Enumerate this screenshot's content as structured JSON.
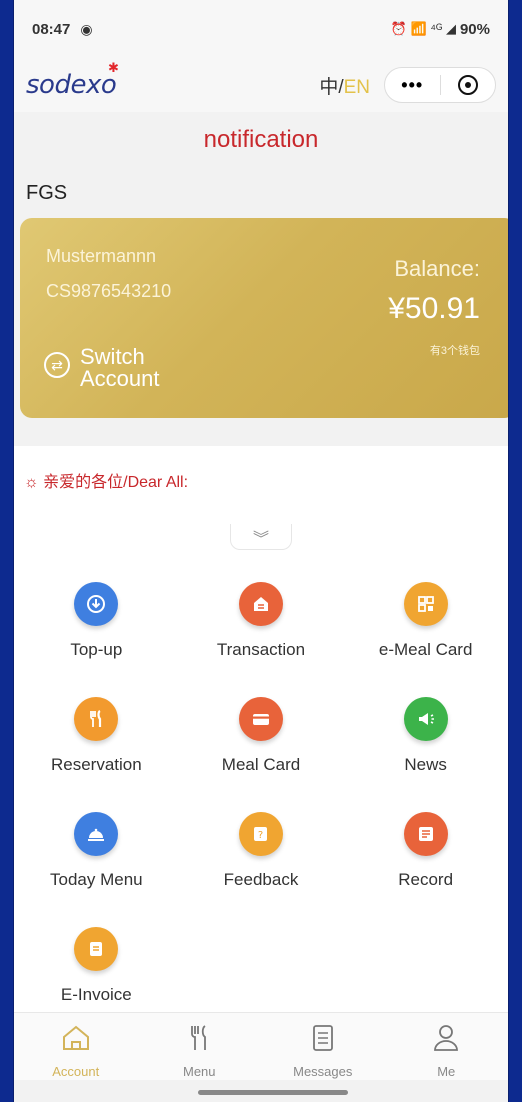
{
  "status_bar": {
    "time": "08:47",
    "indicators": "⏰ 📶 ⁴ᴳ ◢",
    "battery": "90%"
  },
  "header": {
    "logo": "sodexo",
    "lang_zh": "中/",
    "lang_en": "EN",
    "more_label": "•••"
  },
  "page": {
    "title": "notification",
    "org": "FGS"
  },
  "card": {
    "holder": "Mustermannn",
    "account_id": "CS9876543210",
    "switch_label": "Switch Account",
    "balance_label": "Balance:",
    "balance": "¥50.91",
    "wallets": "有3个钱包"
  },
  "notice": {
    "text": "亲爱的各位/Dear All:"
  },
  "grid_items": [
    {
      "label": "Top-up",
      "icon": "topup-icon",
      "color": "#3f7fe0"
    },
    {
      "label": "Transaction",
      "icon": "transaction-icon",
      "color": "#e8633a"
    },
    {
      "label": "e-Meal Card",
      "icon": "qr-code-icon",
      "color": "#f0a531"
    },
    {
      "label": "Reservation",
      "icon": "utensils-icon",
      "color": "#f29a2e"
    },
    {
      "label": "Meal Card",
      "icon": "card-icon",
      "color": "#e8633a"
    },
    {
      "label": "News",
      "icon": "megaphone-icon",
      "color": "#3cb34a"
    },
    {
      "label": "Today Menu",
      "icon": "cloche-icon",
      "color": "#3f7fe0"
    },
    {
      "label": "Feedback",
      "icon": "feedback-icon",
      "color": "#f0a531"
    },
    {
      "label": "Record",
      "icon": "record-icon",
      "color": "#e8633a"
    },
    {
      "label": "E-Invoice",
      "icon": "invoice-icon",
      "color": "#f0a531"
    }
  ],
  "tabs": [
    {
      "label": "Account",
      "icon": "home-icon",
      "active": true
    },
    {
      "label": "Menu",
      "icon": "fork-knife-icon",
      "active": false
    },
    {
      "label": "Messages",
      "icon": "messages-icon",
      "active": false
    },
    {
      "label": "Me",
      "icon": "person-icon",
      "active": false
    }
  ],
  "colors": {
    "accent_gold": "#d3b45a",
    "title_red": "#c8282c",
    "frame_blue": "#0d2a8f"
  }
}
